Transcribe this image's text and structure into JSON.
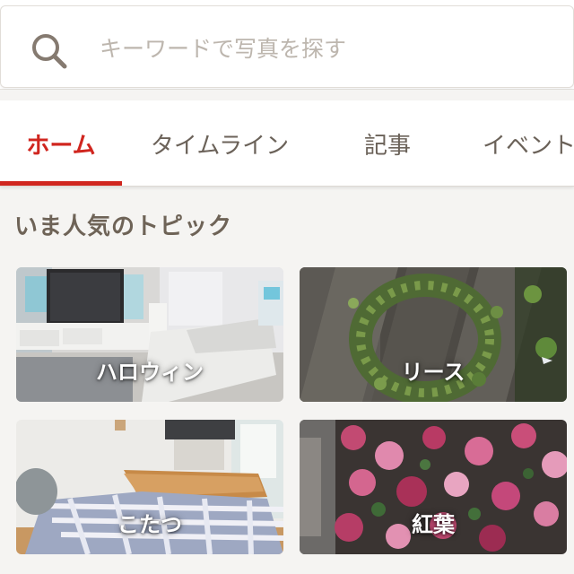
{
  "search": {
    "placeholder": "キーワードで写真を探す"
  },
  "tabs": [
    {
      "label": "ホーム",
      "active": true
    },
    {
      "label": "タイムライン",
      "active": false
    },
    {
      "label": "記事",
      "active": false
    },
    {
      "label": "イベント",
      "active": false
    }
  ],
  "section": {
    "title": "いま人気のトピック"
  },
  "topics": [
    {
      "label": "ハロウィン"
    },
    {
      "label": "リース"
    },
    {
      "label": "こたつ"
    },
    {
      "label": "紅葉"
    }
  ],
  "colors": {
    "accent": "#d0261f",
    "section_title": "#6e6357",
    "tab_text": "#6b6259",
    "background": "#f5f4f2"
  }
}
